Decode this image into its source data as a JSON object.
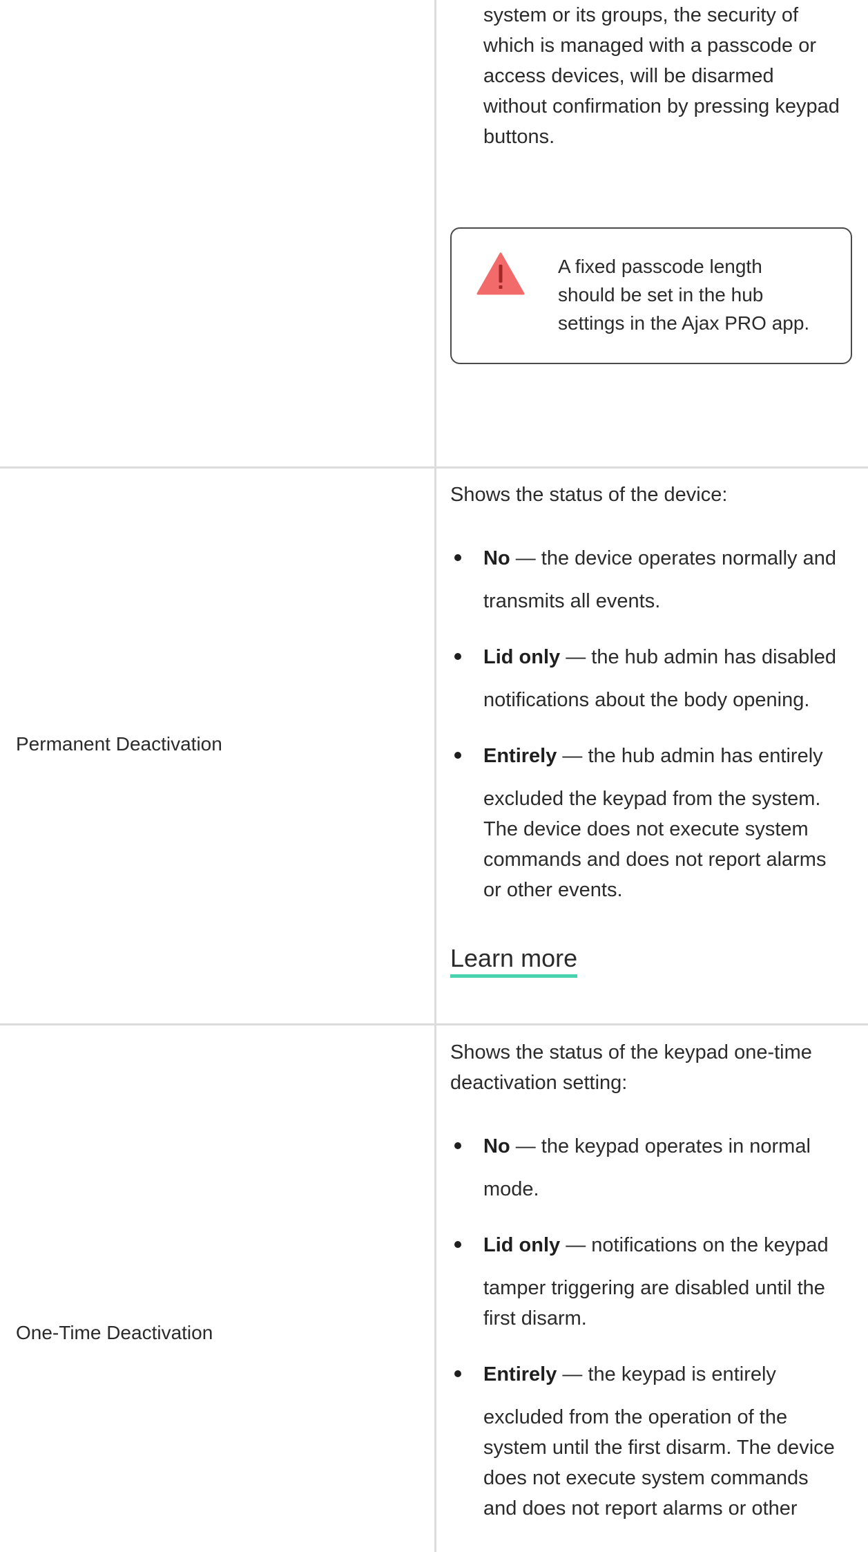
{
  "section1": {
    "text_lines": [
      "system or its groups, the security of",
      "which is managed with a passcode or",
      "access devices, will be disarmed",
      "without confirmation by pressing keypad",
      "buttons."
    ],
    "warning": {
      "icon": "warning-triangle-icon",
      "lines": [
        "A fixed passcode length",
        "should be set in the hub",
        "settings in the Ajax PRO app."
      ]
    }
  },
  "permanent": {
    "label": "Permanent Deactivation",
    "intro": "Shows the status of the device:",
    "items": [
      {
        "term": "No",
        "first": " — the device operates normally and",
        "rest": "transmits all events."
      },
      {
        "term": "Lid only",
        "first": " — the hub admin has disabled",
        "rest": "notifications about the body opening."
      },
      {
        "term": "Entirely",
        "first": " — the hub admin has entirely",
        "rest_lines": [
          "excluded the keypad from the system.",
          "The device does not execute system",
          "commands and does not report alarms",
          "or other events."
        ]
      }
    ],
    "learn_more": "Learn more"
  },
  "onetime": {
    "label": "One-Time Deactivation",
    "intro_lines": [
      "Shows the status of the keypad one-time",
      "deactivation setting:"
    ],
    "items": [
      {
        "term": "No",
        "first": " — the keypad operates in normal",
        "rest": "mode."
      },
      {
        "term": "Lid only",
        "first": " — notifications on the keypad",
        "rest_lines": [
          "tamper triggering are disabled until the",
          "first disarm."
        ]
      },
      {
        "term": "Entirely",
        "first": " — the keypad is entirely",
        "rest_lines": [
          "excluded from the operation of the",
          "system until the first disarm. The device",
          "does not execute system commands",
          "and does not report alarms or other"
        ]
      }
    ]
  },
  "colors": {
    "accent_underline": "#46d3ae",
    "warning_red": "#f36a6a",
    "divider": "#dcdcdc"
  }
}
